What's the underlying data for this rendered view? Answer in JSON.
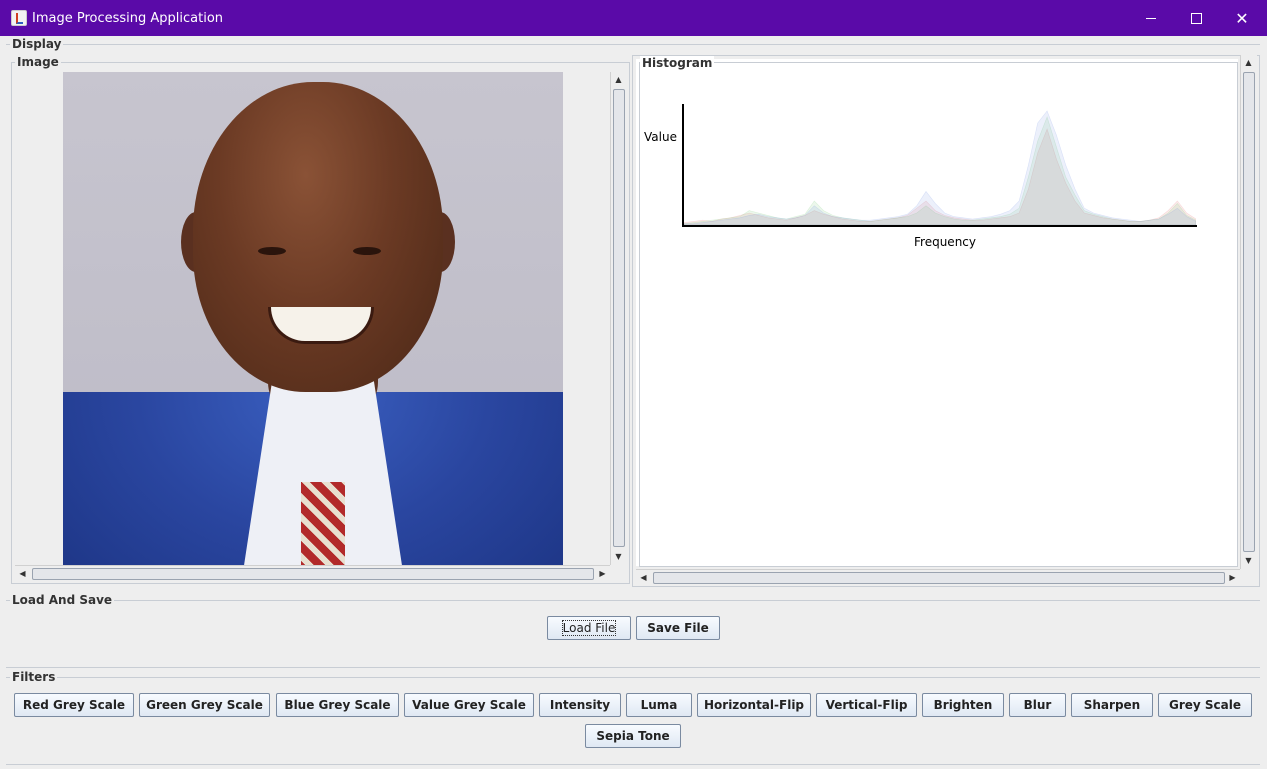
{
  "window": {
    "title": "Image Processing Application",
    "controls": {
      "minimize": "minimize-icon",
      "maximize": "maximize-icon",
      "close": "close-icon"
    }
  },
  "display": {
    "label": "Display",
    "image_panel": {
      "label": "Image"
    },
    "histogram_panel": {
      "label": "Histogram",
      "y_axis_label": "Value",
      "x_axis_label": "Frequency"
    }
  },
  "load_and_save": {
    "label": "Load And Save",
    "load_button": "Load File",
    "save_button": "Save File"
  },
  "filters": {
    "label": "Filters",
    "buttons": [
      "Red Grey Scale",
      "Green Grey Scale",
      "Blue Grey Scale",
      "Value Grey Scale",
      "Intensity",
      "Luma",
      "Horizontal-Flip",
      "Vertical-Flip",
      "Brighten",
      "Blur",
      "Sharpen",
      "Grey Scale",
      "Sepia Tone"
    ]
  },
  "chart_data": {
    "type": "area",
    "xlabel": "Frequency",
    "ylabel": "Value",
    "title": "",
    "series": [
      {
        "color": "#e06060",
        "values": [
          2,
          3,
          4,
          3,
          5,
          6,
          8,
          10,
          8,
          6,
          5,
          4,
          6,
          8,
          12,
          9,
          7,
          5,
          4,
          3,
          3,
          4,
          5,
          6,
          8,
          14,
          20,
          12,
          8,
          6,
          5,
          4,
          4,
          5,
          6,
          7,
          10,
          30,
          60,
          80,
          55,
          35,
          20,
          10,
          8,
          6,
          5,
          4,
          3,
          3,
          4,
          6,
          12,
          20,
          10,
          5
        ]
      },
      {
        "color": "#60c060",
        "values": [
          1,
          2,
          3,
          4,
          5,
          6,
          7,
          12,
          10,
          8,
          6,
          5,
          7,
          9,
          20,
          12,
          8,
          6,
          5,
          4,
          3,
          4,
          5,
          6,
          7,
          10,
          16,
          10,
          7,
          5,
          4,
          4,
          5,
          6,
          7,
          9,
          14,
          40,
          70,
          90,
          65,
          40,
          25,
          12,
          9,
          7,
          5,
          4,
          3,
          3,
          4,
          5,
          10,
          18,
          8,
          4
        ]
      },
      {
        "color": "#6080e0",
        "values": [
          1,
          1,
          2,
          3,
          4,
          5,
          6,
          8,
          9,
          7,
          6,
          5,
          6,
          8,
          16,
          10,
          7,
          6,
          5,
          4,
          4,
          5,
          6,
          7,
          9,
          16,
          28,
          18,
          10,
          7,
          6,
          5,
          6,
          7,
          9,
          12,
          20,
          50,
          85,
          95,
          75,
          50,
          30,
          14,
          10,
          8,
          6,
          5,
          4,
          3,
          4,
          5,
          9,
          14,
          7,
          3
        ]
      }
    ]
  }
}
